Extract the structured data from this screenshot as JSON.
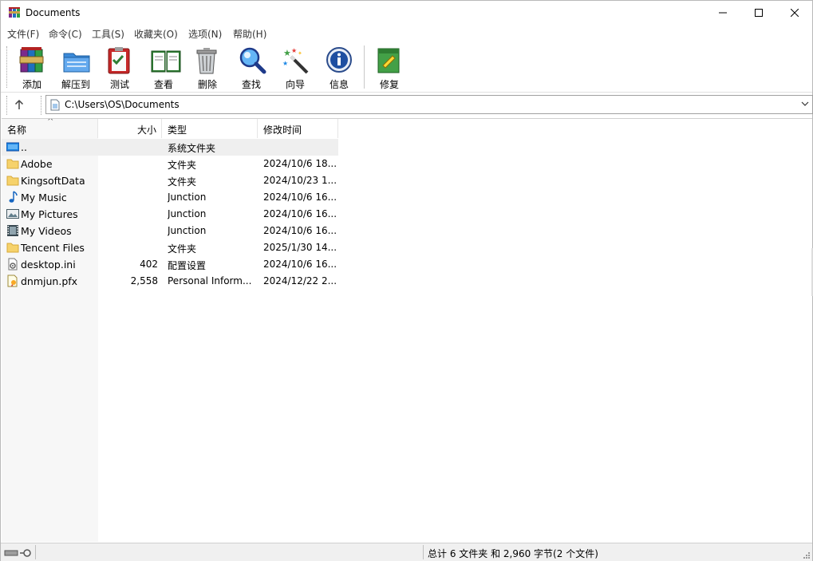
{
  "window": {
    "title": "Documents"
  },
  "menu": [
    {
      "label": "文件(F)"
    },
    {
      "label": "命令(C)"
    },
    {
      "label": "工具(S)"
    },
    {
      "label": "收藏夹(O)"
    },
    {
      "label": "选项(N)"
    },
    {
      "label": "帮助(H)"
    }
  ],
  "toolbar": [
    {
      "label": "添加",
      "icon": "add-archive-icon"
    },
    {
      "label": "解压到",
      "icon": "extract-to-icon"
    },
    {
      "label": "测试",
      "icon": "test-icon"
    },
    {
      "label": "查看",
      "icon": "view-icon"
    },
    {
      "label": "删除",
      "icon": "delete-icon"
    },
    {
      "label": "查找",
      "icon": "find-icon"
    },
    {
      "label": "向导",
      "icon": "wizard-icon"
    },
    {
      "label": "信息",
      "icon": "info-icon"
    },
    {
      "label": "修复",
      "icon": "repair-icon"
    }
  ],
  "address": {
    "path": "C:\\Users\\OS\\Documents"
  },
  "columns": {
    "name": "名称",
    "size": "大小",
    "type": "类型",
    "mtime": "修改时间"
  },
  "files": [
    {
      "name": "..",
      "size": "",
      "type": "系统文件夹",
      "mtime": "",
      "icon": "parent-folder-icon"
    },
    {
      "name": "Adobe",
      "size": "",
      "type": "文件夹",
      "mtime": "2024/10/6 18...",
      "icon": "folder-icon"
    },
    {
      "name": "KingsoftData",
      "size": "",
      "type": "文件夹",
      "mtime": "2024/10/23 1...",
      "icon": "folder-icon"
    },
    {
      "name": "My Music",
      "size": "",
      "type": "Junction",
      "mtime": "2024/10/6 16...",
      "icon": "music-icon"
    },
    {
      "name": "My Pictures",
      "size": "",
      "type": "Junction",
      "mtime": "2024/10/6 16...",
      "icon": "pictures-icon"
    },
    {
      "name": "My Videos",
      "size": "",
      "type": "Junction",
      "mtime": "2024/10/6 16...",
      "icon": "videos-icon"
    },
    {
      "name": "Tencent Files",
      "size": "",
      "type": "文件夹",
      "mtime": "2025/1/30 14...",
      "icon": "folder-icon"
    },
    {
      "name": "desktop.ini",
      "size": "402",
      "type": "配置设置",
      "mtime": "2024/10/6 16...",
      "icon": "ini-file-icon"
    },
    {
      "name": "dnmjun.pfx",
      "size": "2,558",
      "type": "Personal Inform...",
      "mtime": "2024/12/22 2...",
      "icon": "certificate-file-icon"
    }
  ],
  "status": {
    "summary": "总计 6 文件夹 和 2,960 字节(2 个文件)"
  }
}
